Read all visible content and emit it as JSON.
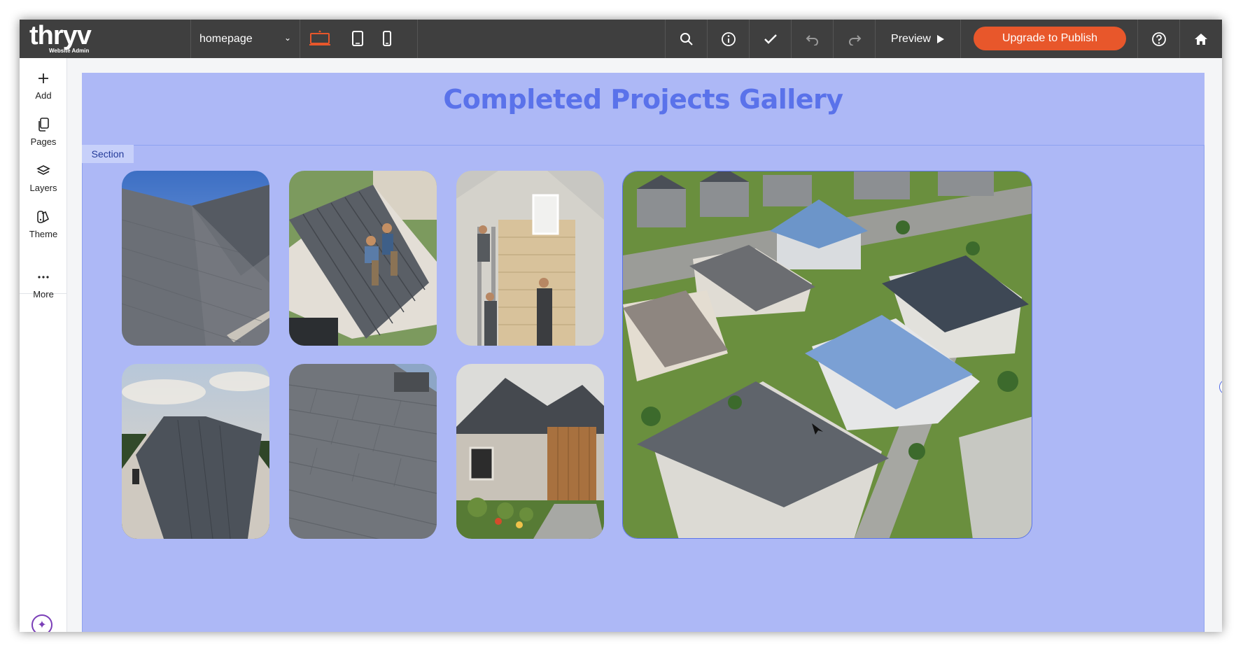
{
  "brand": {
    "logo": "thryv",
    "sub": "Website Admin"
  },
  "toolbar": {
    "page_select": "homepage",
    "devices": [
      "desktop-icon",
      "tablet-icon",
      "mobile-icon"
    ],
    "tools": [
      "search-icon",
      "info-icon",
      "check-icon",
      "undo-icon",
      "redo-icon"
    ],
    "preview_label": "Preview",
    "upgrade_label": "Upgrade to Publish",
    "accent": "#e8572b"
  },
  "sidebar": {
    "items": [
      {
        "label": "Add",
        "icon": "plus-icon"
      },
      {
        "label": "Pages",
        "icon": "pages-icon"
      },
      {
        "label": "Layers",
        "icon": "layers-icon"
      },
      {
        "label": "Theme",
        "icon": "theme-icon"
      },
      {
        "label": "More",
        "icon": "more-icon"
      }
    ]
  },
  "section": {
    "tag": "Section",
    "title": "Completed Projects Gallery",
    "background": "#adb8f6",
    "title_color": "#5a72ea"
  },
  "gallery": {
    "images": [
      "asphalt-shingle-roof-photo",
      "metal-roof-installation-photo",
      "siding-installation-photo",
      "metal-roof-house-photo",
      "shingle-closeup-photo",
      "modern-farmhouse-photo",
      "aerial-neighborhood-photo"
    ]
  }
}
